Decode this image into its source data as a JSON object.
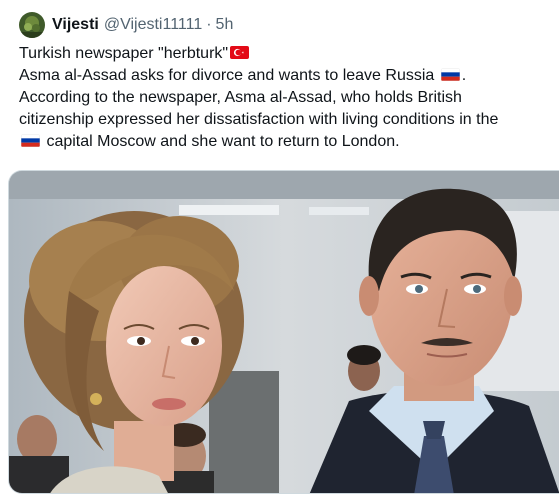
{
  "tweet": {
    "author_name": "Vijesti",
    "author_handle": "@Vijesti11111",
    "separator": "·",
    "timestamp": "5h",
    "avatar_icon": "avatar-icon",
    "lines": {
      "l1": "Turkish newspaper \"herbturk\"",
      "l2": "Asma al-Assad asks for divorce and wants to leave Russia",
      "l2_end": ".",
      "l3": "According to the newspaper, Asma al-Assad, who holds British",
      "l4": "citizenship expressed her dissatisfaction with living conditions in the",
      "l5": "capital Moscow and she want to return to London."
    },
    "flags": {
      "turkey": "turkey-flag-icon",
      "russia": "russia-flag-icon"
    }
  },
  "colors": {
    "text": "#0f1419",
    "muted": "#536471",
    "border": "#cfd9de",
    "turkey_red": "#e30a17",
    "russia_white": "#ffffff",
    "russia_blue": "#0039a6",
    "russia_red": "#d52b1e"
  }
}
